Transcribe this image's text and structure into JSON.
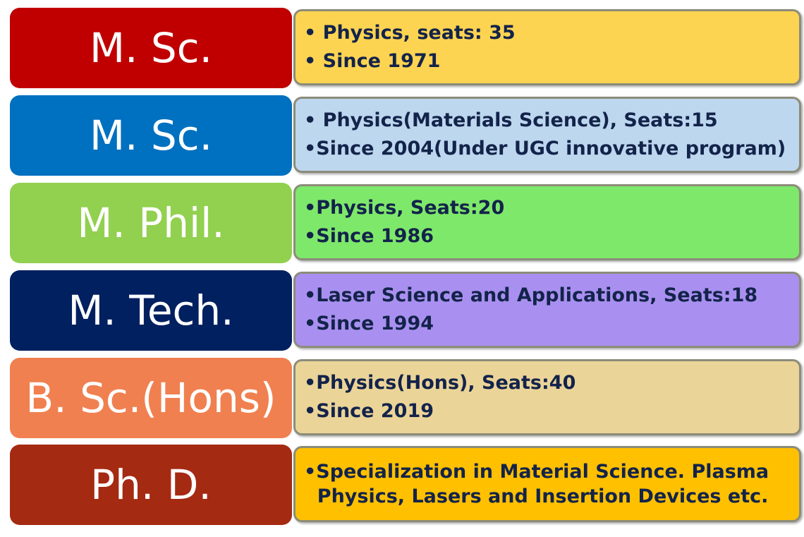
{
  "rows": [
    {
      "degree": "M. Sc.",
      "degree_color": "#C00000",
      "detail_color": "#FDD451",
      "lines": [
        "• Physics,  seats: 35",
        "• Since 1971"
      ]
    },
    {
      "degree": "M. Sc.",
      "degree_color": "#0070C0",
      "detail_color": "#BDD7EE",
      "lines": [
        "•  Physics(Materials Science), Seats:15",
        "•Since 2004(Under UGC innovative program)"
      ]
    },
    {
      "degree": "M. Phil.",
      "degree_color": "#92D050",
      "detail_color": "#7EE86A",
      "lines": [
        "•Physics, Seats:20",
        "•Since 1986"
      ]
    },
    {
      "degree": "M. Tech.",
      "degree_color": "#002060",
      "detail_color": "#A990F0",
      "lines": [
        "•Laser Science and Applications, Seats:18",
        "•Since 1994"
      ]
    },
    {
      "degree": "B. Sc.(Hons)",
      "degree_color": "#F08050",
      "detail_color": "#EBD498",
      "lines": [
        "•Physics(Hons),  Seats:40",
        "•Since 2019"
      ]
    },
    {
      "degree": "Ph. D.",
      "degree_color": "#A52A12",
      "detail_color": "#FFC000",
      "lines": [
        "•Specialization in Material Science. Plasma",
        "  Physics, Lasers and Insertion Devices etc."
      ]
    }
  ]
}
